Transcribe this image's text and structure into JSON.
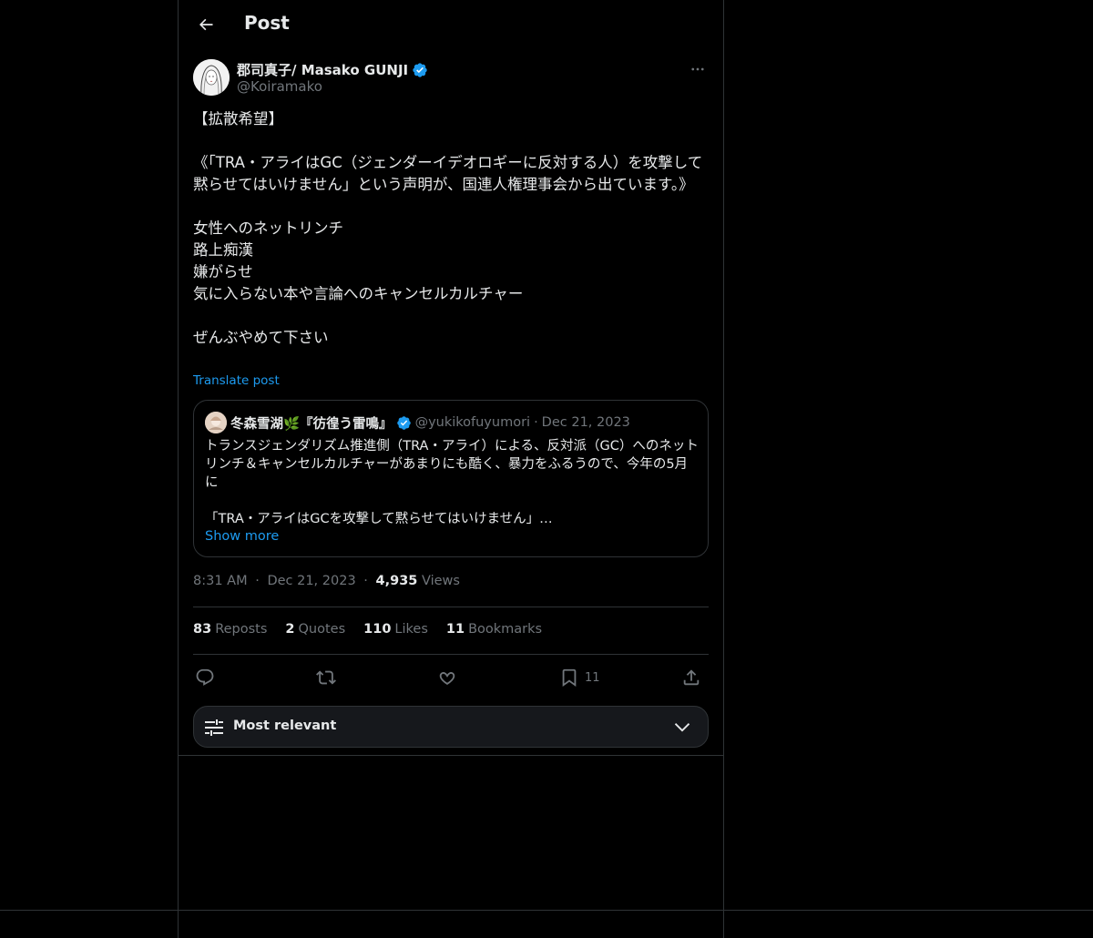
{
  "header": {
    "title": "Post"
  },
  "post": {
    "author": {
      "display_name": "郡司真子/ Masako GUNJI",
      "handle": "@Koiramako"
    },
    "text": "【拡散希望】\n\n《「TRA・アライはGC（ジェンダーイデオロギーに反対する人）を攻撃して黙らせてはいけません」という声明が、国連人権理事会から出ています。》\n\n女性へのネットリンチ\n路上痴漢\n嫌がらせ\n気に入らない本や言論へのキャンセルカルチャー\n\nぜんぶやめて下さい",
    "translate_label": "Translate post",
    "quote": {
      "display_name": "冬森雪湖🌿『彷徨う雷鳴』",
      "handle": "@yukikofuyumori",
      "separator": "·",
      "date": "Dec 21, 2023",
      "text": "トランスジェンダリズム推進側（TRA・アライ）による、反対派（GC）へのネットリンチ＆キャンセルカルチャーがあまりにも酷く、暴力をふるうので、今年の5月に\n\n「TRA・アライはGCを攻撃して黙らせてはいけません」…",
      "show_more": "Show more"
    },
    "meta": {
      "time": "8:31 AM",
      "separator": "·",
      "date": "Dec 21, 2023",
      "views_count": "4,935",
      "views_label": "Views"
    },
    "stats": {
      "reposts_count": "83",
      "reposts_label": "Reposts",
      "quotes_count": "2",
      "quotes_label": "Quotes",
      "likes_count": "110",
      "likes_label": "Likes",
      "bookmarks_count": "11",
      "bookmarks_label": "Bookmarks"
    },
    "actions": {
      "bookmark_count": "11"
    }
  },
  "sort": {
    "label": "Most relevant"
  },
  "icons": {
    "back": "arrow-left-icon",
    "verified": "verified-badge-icon",
    "more": "more-horizontal-icon",
    "reply": "reply-icon",
    "repost": "repost-icon",
    "like": "heart-icon",
    "bookmark": "bookmark-icon",
    "share": "share-icon",
    "sort": "sliders-icon",
    "chevron": "chevron-down-icon"
  },
  "colors": {
    "background": "#000000",
    "text": "#e7e9ea",
    "muted": "#71767b",
    "accent": "#1d9bf0",
    "border": "#2f3336"
  }
}
